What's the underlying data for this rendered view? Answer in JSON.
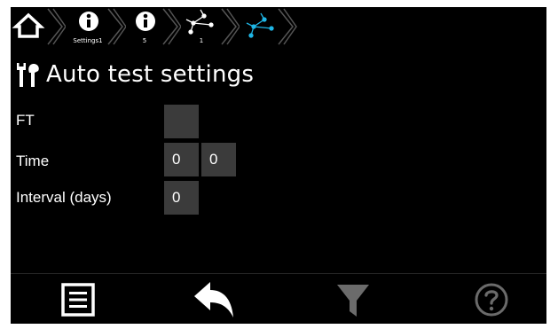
{
  "breadcrumb": {
    "items": [
      {
        "icon": "home-icon",
        "label": ""
      },
      {
        "icon": "info-icon",
        "label": "Settings1"
      },
      {
        "icon": "info-icon",
        "label": "5"
      },
      {
        "icon": "network-icon",
        "label": "1"
      },
      {
        "icon": "network-icon",
        "label": ""
      }
    ],
    "active_color": "#1fb6e6"
  },
  "page": {
    "title": "Auto test settings",
    "title_icon": "tools-icon"
  },
  "settings": {
    "ft_label": "FT",
    "ft_value": "",
    "time_label": "Time",
    "time_hours": "0",
    "time_minutes": "0",
    "interval_label": "Interval (days)",
    "interval_value": "0"
  },
  "bottom_bar": {
    "items": [
      "menu-icon",
      "back-icon",
      "filter-icon",
      "help-icon"
    ]
  }
}
